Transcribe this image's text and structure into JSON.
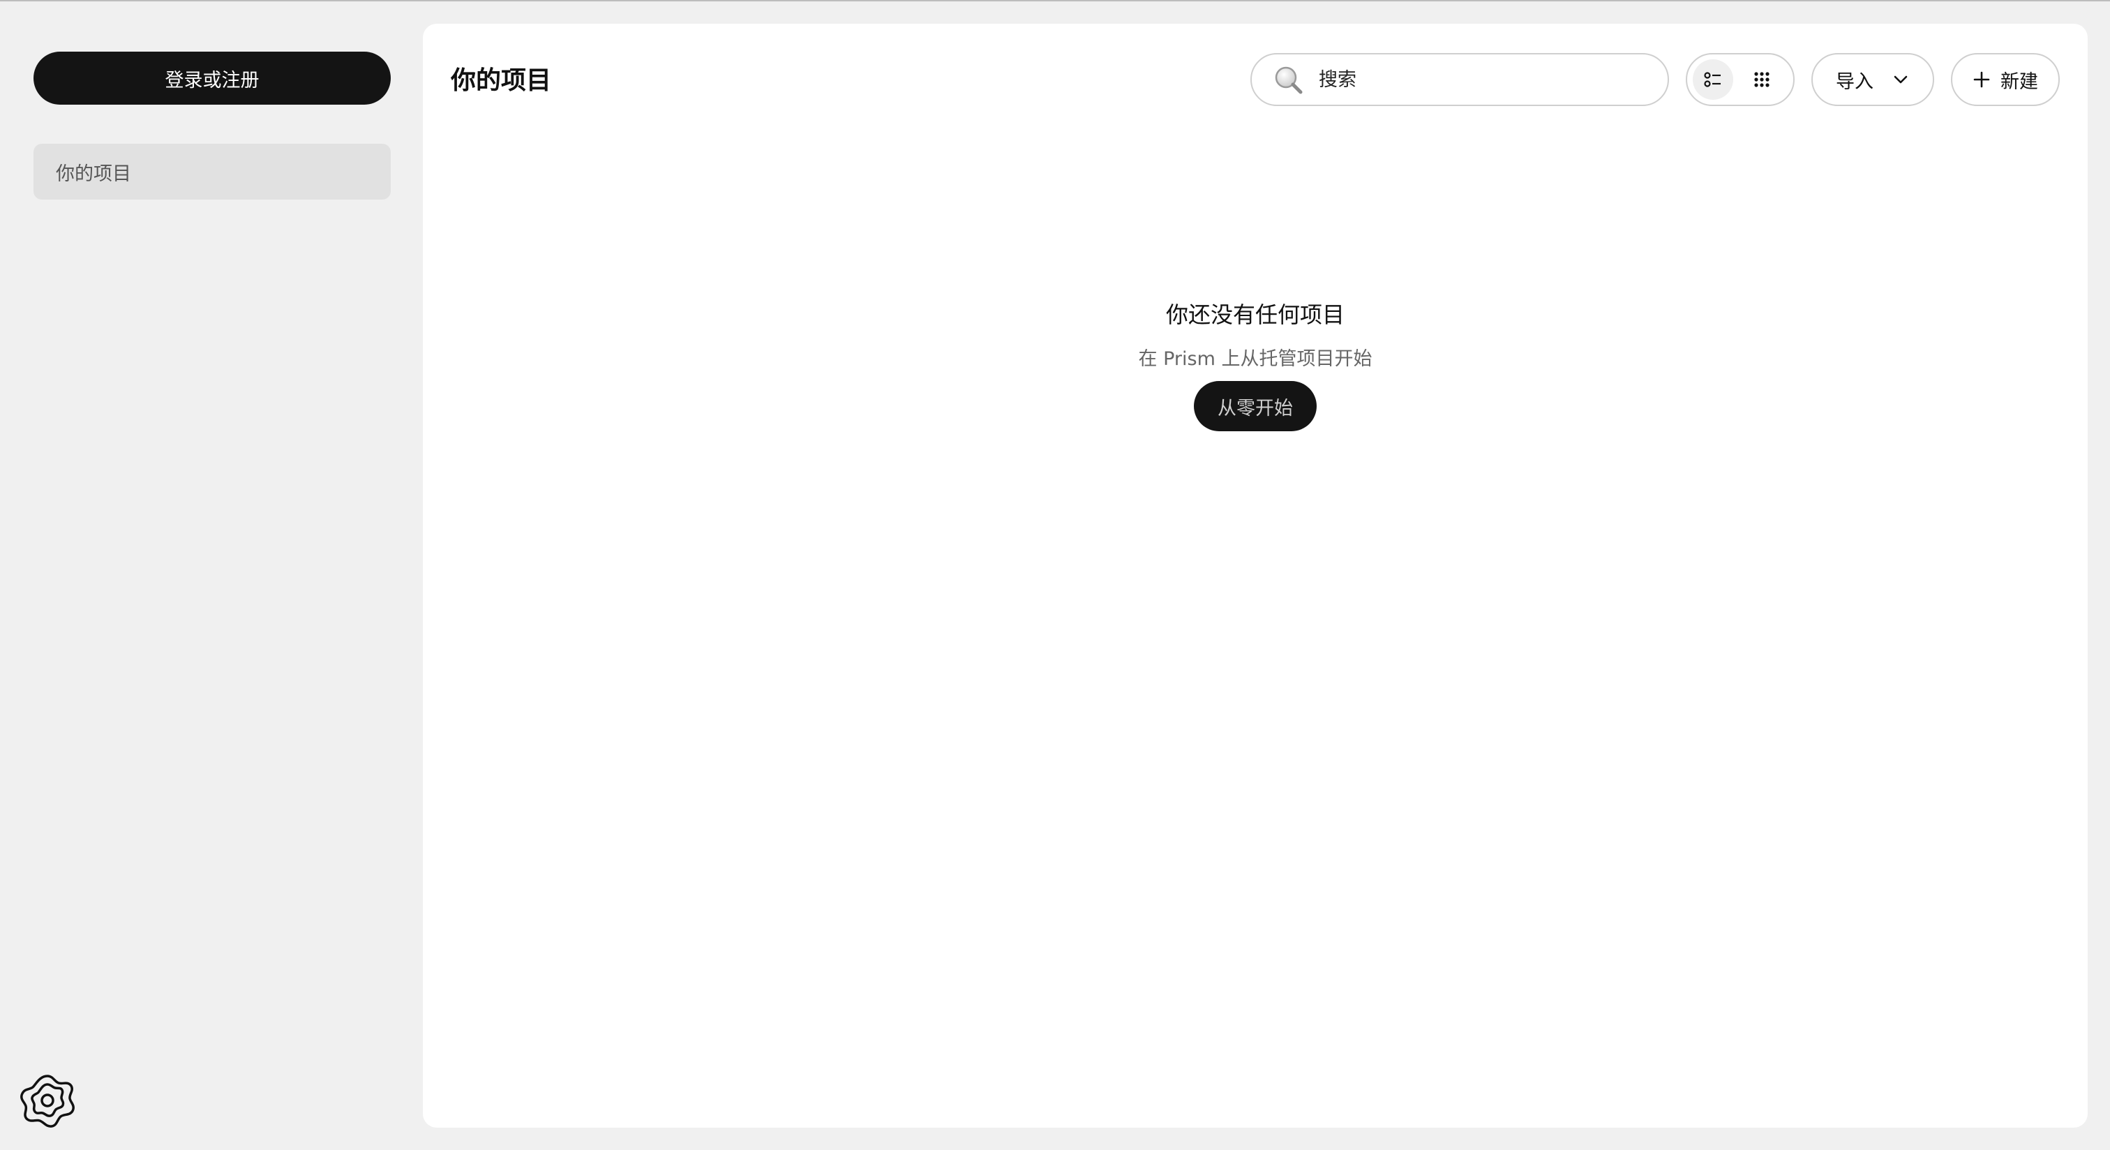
{
  "sidebar": {
    "login_label": "登录或注册",
    "items": [
      {
        "label": "你的项目"
      }
    ],
    "settings_icon": "settings-flower-icon"
  },
  "header": {
    "title": "你的项目",
    "search": {
      "placeholder": "搜索",
      "value": "",
      "icon": "search-icon"
    },
    "view_toggle": {
      "options": [
        {
          "name": "list-view",
          "icon": "list-view-icon",
          "active": true
        },
        {
          "name": "grid-view",
          "icon": "grid-view-icon",
          "active": false
        }
      ]
    },
    "import_label": "导入",
    "new_label": "新建"
  },
  "empty_state": {
    "title": "你还没有任何项目",
    "subtitle": "在 Prism 上从托管项目开始",
    "button_label": "从零开始"
  },
  "colors": {
    "background": "#f0f0f0",
    "panel": "#ffffff",
    "primary_button": "#141414",
    "nav_active": "#e1e1e1",
    "border": "#cfcfcf"
  }
}
